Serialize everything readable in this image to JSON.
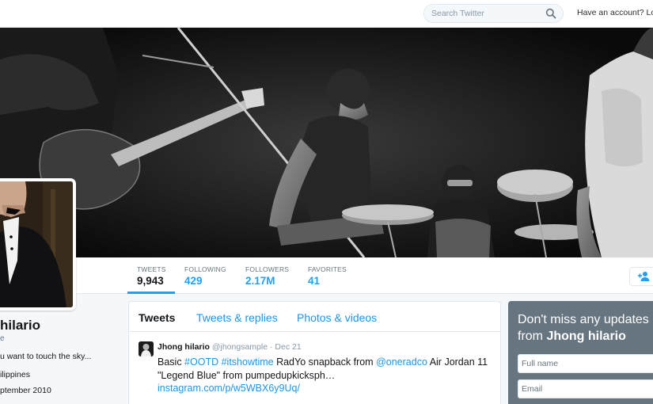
{
  "header": {
    "search_placeholder": "Search Twitter",
    "account_text": "Have an account? Log in"
  },
  "banner": {
    "image": "black-and-white band performing on stage (guitarists, drummer with cymbals)"
  },
  "stats": [
    {
      "label": "TWEETS",
      "value": "9,943"
    },
    {
      "label": "FOLLOWING",
      "value": "429"
    },
    {
      "label": "FOLLOWERS",
      "value": "2.17M"
    },
    {
      "label": "FAVORITES",
      "value": "41"
    }
  ],
  "profile": {
    "name": "hilario",
    "handle": "e",
    "bio": "u want to touch the sky...",
    "location": "ilippines",
    "joined": "ptember 2010"
  },
  "timeline": {
    "tabs": [
      "Tweets",
      "Tweets & replies",
      "Photos & videos"
    ],
    "tweet": {
      "name": "Jhong hilario",
      "handle": "@jhongsample",
      "separator": "·",
      "date": "Dec 21",
      "text_1": "Basic ",
      "hashtag_1": "#OOTD",
      "text_2": " ",
      "hashtag_2": "#itshowtime",
      "text_3": " RadYo snapback from ",
      "mention": "@oneradco",
      "text_4": " Air Jordan 11 \"Legend Blue\" from pumpedupkicksph…",
      "url": "instagram.com/p/w5WBX6y9Uq/"
    }
  },
  "signup": {
    "line1": "Don't miss any updates",
    "line2_prefix": "from ",
    "line2_name": "Jhong hilario",
    "fullname_placeholder": "Full name",
    "email_placeholder": "Email"
  },
  "colors": {
    "accent": "#1da1f2",
    "link": "#1b95e0",
    "signup_bg": "#66757f",
    "background": "#f5f8fa"
  },
  "icons": {
    "search": "search-icon",
    "follow": "add-user-icon"
  }
}
